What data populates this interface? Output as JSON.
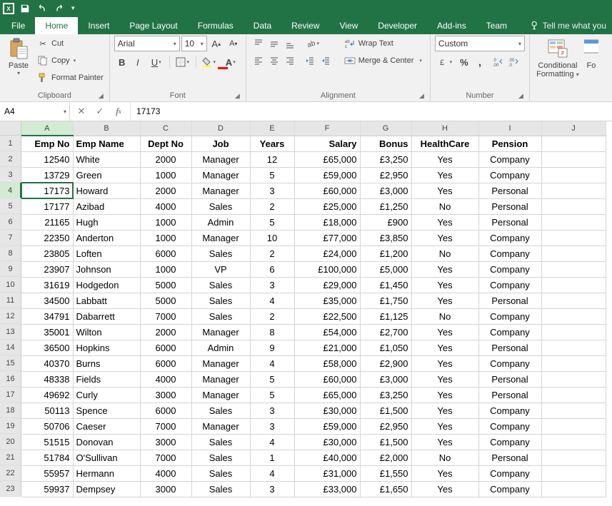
{
  "qat": {
    "save": "save-icon",
    "undo": "undo-icon",
    "redo": "redo-icon"
  },
  "tabs": {
    "file": "File",
    "home": "Home",
    "insert": "Insert",
    "pagelayout": "Page Layout",
    "formulas": "Formulas",
    "data": "Data",
    "review": "Review",
    "view": "View",
    "developer": "Developer",
    "addins": "Add-ins",
    "team": "Team"
  },
  "tellme": "Tell me what you",
  "ribbon": {
    "clipboard": {
      "label": "Clipboard",
      "paste": "Paste",
      "cut": "Cut",
      "copy": "Copy",
      "painter": "Format Painter"
    },
    "font": {
      "label": "Font",
      "name": "Arial",
      "size": "10",
      "bold": "B",
      "italic": "I",
      "underline": "U"
    },
    "alignment": {
      "label": "Alignment",
      "wrap": "Wrap Text",
      "merge": "Merge & Center"
    },
    "number": {
      "label": "Number",
      "format": "Custom"
    },
    "styles": {
      "cond": "Conditional",
      "cond2": "Formatting",
      "fo": "Fo"
    }
  },
  "formula_bar": {
    "name_box": "A4",
    "formula": "17173"
  },
  "columns": [
    "A",
    "B",
    "C",
    "D",
    "E",
    "F",
    "G",
    "H",
    "I",
    "J"
  ],
  "active_col": "A",
  "row_count": 23,
  "active_row": 4,
  "headers": [
    "Emp No",
    "Emp Name",
    "Dept No",
    "Job",
    "Years",
    "Salary",
    "Bonus",
    "HealthCare",
    "Pension"
  ],
  "rows": [
    {
      "empno": "12540",
      "name": "White",
      "deptno": "2000",
      "job": "Manager",
      "years": "12",
      "salary": "£65,000",
      "bonus": "£3,250",
      "health": "Yes",
      "pension": "Company"
    },
    {
      "empno": "13729",
      "name": "Green",
      "deptno": "1000",
      "job": "Manager",
      "years": "5",
      "salary": "£59,000",
      "bonus": "£2,950",
      "health": "Yes",
      "pension": "Company"
    },
    {
      "empno": "17173",
      "name": "Howard",
      "deptno": "2000",
      "job": "Manager",
      "years": "3",
      "salary": "£60,000",
      "bonus": "£3,000",
      "health": "Yes",
      "pension": "Personal"
    },
    {
      "empno": "17177",
      "name": "Azibad",
      "deptno": "4000",
      "job": "Sales",
      "years": "2",
      "salary": "£25,000",
      "bonus": "£1,250",
      "health": "No",
      "pension": "Personal"
    },
    {
      "empno": "21165",
      "name": "Hugh",
      "deptno": "1000",
      "job": "Admin",
      "years": "5",
      "salary": "£18,000",
      "bonus": "£900",
      "health": "Yes",
      "pension": "Personal"
    },
    {
      "empno": "22350",
      "name": "Anderton",
      "deptno": "1000",
      "job": "Manager",
      "years": "10",
      "salary": "£77,000",
      "bonus": "£3,850",
      "health": "Yes",
      "pension": "Company"
    },
    {
      "empno": "23805",
      "name": "Loften",
      "deptno": "6000",
      "job": "Sales",
      "years": "2",
      "salary": "£24,000",
      "bonus": "£1,200",
      "health": "No",
      "pension": "Company"
    },
    {
      "empno": "23907",
      "name": "Johnson",
      "deptno": "1000",
      "job": "VP",
      "years": "6",
      "salary": "£100,000",
      "bonus": "£5,000",
      "health": "Yes",
      "pension": "Company"
    },
    {
      "empno": "31619",
      "name": "Hodgedon",
      "deptno": "5000",
      "job": "Sales",
      "years": "3",
      "salary": "£29,000",
      "bonus": "£1,450",
      "health": "Yes",
      "pension": "Company"
    },
    {
      "empno": "34500",
      "name": "Labbatt",
      "deptno": "5000",
      "job": "Sales",
      "years": "4",
      "salary": "£35,000",
      "bonus": "£1,750",
      "health": "Yes",
      "pension": "Personal"
    },
    {
      "empno": "34791",
      "name": "Dabarrett",
      "deptno": "7000",
      "job": "Sales",
      "years": "2",
      "salary": "£22,500",
      "bonus": "£1,125",
      "health": "No",
      "pension": "Company"
    },
    {
      "empno": "35001",
      "name": "Wilton",
      "deptno": "2000",
      "job": "Manager",
      "years": "8",
      "salary": "£54,000",
      "bonus": "£2,700",
      "health": "Yes",
      "pension": "Company"
    },
    {
      "empno": "36500",
      "name": "Hopkins",
      "deptno": "6000",
      "job": "Admin",
      "years": "9",
      "salary": "£21,000",
      "bonus": "£1,050",
      "health": "Yes",
      "pension": "Personal"
    },
    {
      "empno": "40370",
      "name": "Burns",
      "deptno": "6000",
      "job": "Manager",
      "years": "4",
      "salary": "£58,000",
      "bonus": "£2,900",
      "health": "Yes",
      "pension": "Company"
    },
    {
      "empno": "48338",
      "name": "Fields",
      "deptno": "4000",
      "job": "Manager",
      "years": "5",
      "salary": "£60,000",
      "bonus": "£3,000",
      "health": "Yes",
      "pension": "Personal"
    },
    {
      "empno": "49692",
      "name": "Curly",
      "deptno": "3000",
      "job": "Manager",
      "years": "5",
      "salary": "£65,000",
      "bonus": "£3,250",
      "health": "Yes",
      "pension": "Personal"
    },
    {
      "empno": "50113",
      "name": "Spence",
      "deptno": "6000",
      "job": "Sales",
      "years": "3",
      "salary": "£30,000",
      "bonus": "£1,500",
      "health": "Yes",
      "pension": "Company"
    },
    {
      "empno": "50706",
      "name": "Caeser",
      "deptno": "7000",
      "job": "Manager",
      "years": "3",
      "salary": "£59,000",
      "bonus": "£2,950",
      "health": "Yes",
      "pension": "Company"
    },
    {
      "empno": "51515",
      "name": "Donovan",
      "deptno": "3000",
      "job": "Sales",
      "years": "4",
      "salary": "£30,000",
      "bonus": "£1,500",
      "health": "Yes",
      "pension": "Company"
    },
    {
      "empno": "51784",
      "name": "O'Sullivan",
      "deptno": "7000",
      "job": "Sales",
      "years": "1",
      "salary": "£40,000",
      "bonus": "£2,000",
      "health": "No",
      "pension": "Personal"
    },
    {
      "empno": "55957",
      "name": "Hermann",
      "deptno": "4000",
      "job": "Sales",
      "years": "4",
      "salary": "£31,000",
      "bonus": "£1,550",
      "health": "Yes",
      "pension": "Company"
    },
    {
      "empno": "59937",
      "name": "Dempsey",
      "deptno": "3000",
      "job": "Sales",
      "years": "3",
      "salary": "£33,000",
      "bonus": "£1,650",
      "health": "Yes",
      "pension": "Company"
    }
  ]
}
